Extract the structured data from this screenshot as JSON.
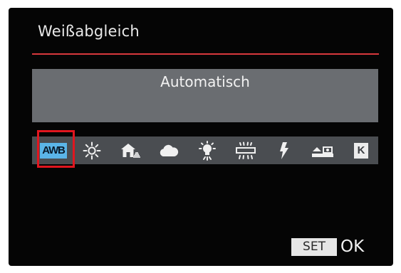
{
  "menu": {
    "title": "Weißabgleich",
    "selected_mode": "Automatisch"
  },
  "wb_options": [
    {
      "label": "AWB",
      "icon": "awb-icon",
      "selected": true
    },
    {
      "icon": "daylight-sun-icon"
    },
    {
      "icon": "shade-icon"
    },
    {
      "icon": "cloudy-icon"
    },
    {
      "icon": "tungsten-icon"
    },
    {
      "icon": "fluorescent-icon"
    },
    {
      "icon": "flash-icon"
    },
    {
      "icon": "custom-wb-icon"
    },
    {
      "label": "K",
      "icon": "color-temperature-icon"
    }
  ],
  "footer": {
    "set_label": "SET",
    "ok_label": "OK"
  },
  "colors": {
    "accent_red": "#e0161f",
    "awb_blue": "#5bb5e8",
    "panel_gray": "#6a6d71",
    "strip_gray": "#4a4d51",
    "background": "#050505"
  }
}
